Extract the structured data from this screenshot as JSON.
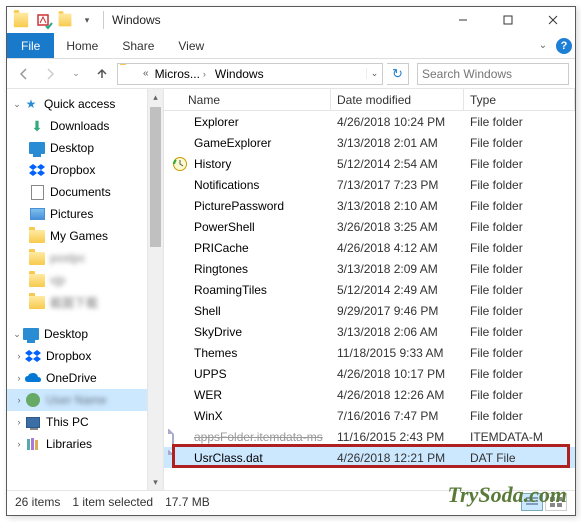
{
  "window": {
    "title": "Windows"
  },
  "menu": {
    "file": "File",
    "tabs": [
      "Home",
      "Share",
      "View"
    ]
  },
  "breadcrumb": {
    "items": [
      "Micros...",
      "Windows"
    ]
  },
  "search": {
    "placeholder": "Search Windows"
  },
  "nav": {
    "quick_access": "Quick access",
    "items1": [
      {
        "label": "Downloads",
        "icon": "download"
      },
      {
        "label": "Desktop",
        "icon": "desk"
      },
      {
        "label": "Dropbox",
        "icon": "dropbox"
      },
      {
        "label": "Documents",
        "icon": "doc"
      },
      {
        "label": "Pictures",
        "icon": "pic"
      },
      {
        "label": "My Games",
        "icon": "folder"
      },
      {
        "label": "postpc",
        "icon": "folder",
        "blur": true
      },
      {
        "label": "vjp",
        "icon": "folder",
        "blur": true
      },
      {
        "label": "截圖下載",
        "icon": "folder",
        "blur": true
      }
    ],
    "desktop": "Desktop",
    "items2": [
      {
        "label": "Dropbox",
        "icon": "dropbox"
      },
      {
        "label": "OneDrive",
        "icon": "onedrive"
      },
      {
        "label": "User Name",
        "icon": "user",
        "sel": true,
        "blur": true
      },
      {
        "label": "This PC",
        "icon": "pc"
      },
      {
        "label": "Libraries",
        "icon": "lib"
      }
    ]
  },
  "columns": {
    "name": "Name",
    "date": "Date modified",
    "type": "Type"
  },
  "files": [
    {
      "name": "Explorer",
      "date": "4/26/2018 10:24 PM",
      "type": "File folder",
      "icon": "folder"
    },
    {
      "name": "GameExplorer",
      "date": "3/13/2018 2:01 AM",
      "type": "File folder",
      "icon": "folder"
    },
    {
      "name": "History",
      "date": "5/12/2014 2:54 AM",
      "type": "File folder",
      "icon": "history"
    },
    {
      "name": "Notifications",
      "date": "7/13/2017 7:23 PM",
      "type": "File folder",
      "icon": "folder"
    },
    {
      "name": "PicturePassword",
      "date": "3/13/2018 2:10 AM",
      "type": "File folder",
      "icon": "folder"
    },
    {
      "name": "PowerShell",
      "date": "3/26/2018 3:25 AM",
      "type": "File folder",
      "icon": "folder"
    },
    {
      "name": "PRICache",
      "date": "4/26/2018 4:12 AM",
      "type": "File folder",
      "icon": "folder"
    },
    {
      "name": "Ringtones",
      "date": "3/13/2018 2:09 AM",
      "type": "File folder",
      "icon": "folder"
    },
    {
      "name": "RoamingTiles",
      "date": "5/12/2014 2:49 AM",
      "type": "File folder",
      "icon": "folder"
    },
    {
      "name": "Shell",
      "date": "9/29/2017 9:46 PM",
      "type": "File folder",
      "icon": "folder"
    },
    {
      "name": "SkyDrive",
      "date": "3/13/2018 2:06 AM",
      "type": "File folder",
      "icon": "folder"
    },
    {
      "name": "Themes",
      "date": "11/18/2015 9:33 AM",
      "type": "File folder",
      "icon": "folder"
    },
    {
      "name": "UPPS",
      "date": "4/26/2018 10:17 PM",
      "type": "File folder",
      "icon": "folder"
    },
    {
      "name": "WER",
      "date": "4/26/2018 12:26 AM",
      "type": "File folder",
      "icon": "folder"
    },
    {
      "name": "WinX",
      "date": "7/16/2016 7:47 PM",
      "type": "File folder",
      "icon": "folder"
    },
    {
      "name": "appsFolder.itemdata-ms",
      "date": "11/16/2015 2:43 PM",
      "type": "ITEMDATA-M",
      "icon": "file",
      "strike": true
    },
    {
      "name": "UsrClass.dat",
      "date": "4/26/2018 12:21 PM",
      "type": "DAT File",
      "icon": "file",
      "sel": true,
      "highlight": true
    }
  ],
  "status": {
    "count": "26 items",
    "selection": "1 item selected",
    "size": "17.7 MB"
  },
  "watermark": "TrySoda.com"
}
